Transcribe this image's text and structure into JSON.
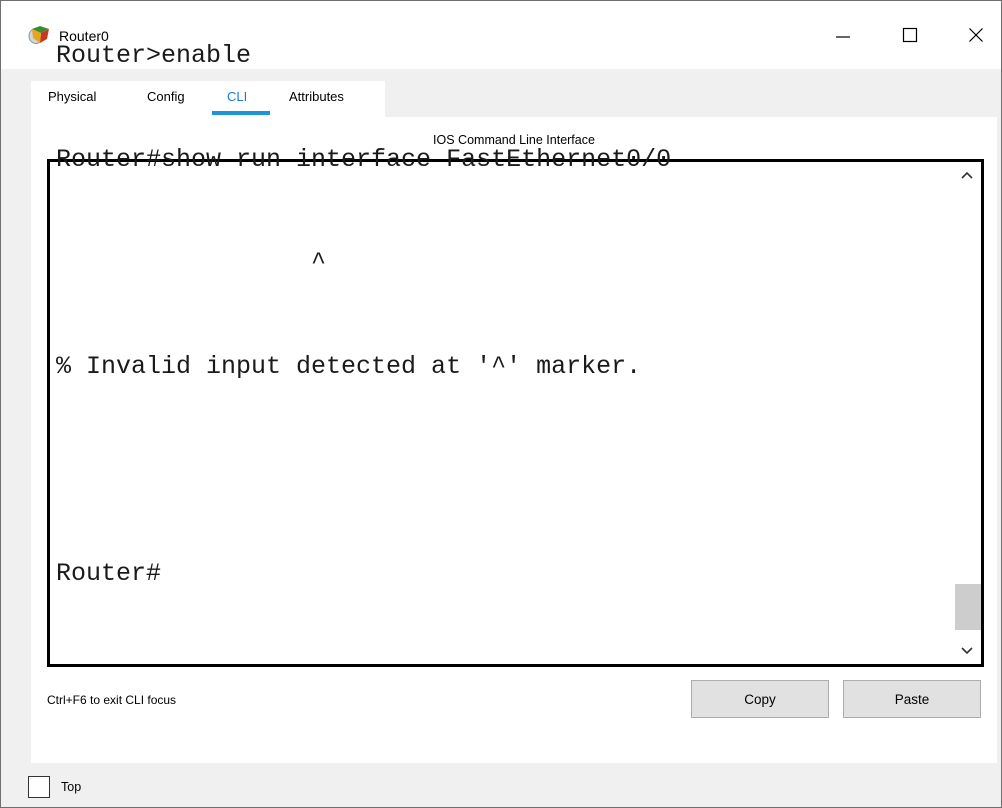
{
  "window": {
    "title": "Router0",
    "icon": "router-app-icon",
    "controls": {
      "minimize": "minimize-icon",
      "maximize": "maximize-icon",
      "close": "close-icon"
    }
  },
  "tabs": [
    {
      "label": "Physical",
      "active": false
    },
    {
      "label": "Config",
      "active": false
    },
    {
      "label": "CLI",
      "active": true
    },
    {
      "label": "Attributes",
      "active": false
    }
  ],
  "panel": {
    "title": "IOS Command Line Interface"
  },
  "console": {
    "lines": [
      "Router>enable",
      "Router#show run interface FastEthernet0/0",
      "                 ^",
      "% Invalid input detected at '^' marker.",
      "",
      "Router#"
    ]
  },
  "scrollbar": {
    "up_icon": "chevron-up-icon",
    "down_icon": "chevron-down-icon"
  },
  "footer_hint": "Ctrl+F6 to exit CLI focus",
  "buttons": {
    "copy": "Copy",
    "paste": "Paste"
  },
  "top_checkbox": {
    "label": "Top",
    "checked": false
  },
  "colors": {
    "active_tab_text": "#1a7bd2",
    "active_tab_underline": "#1d95d7",
    "window_bg": "#f0f0f0",
    "console_border": "#000000"
  }
}
